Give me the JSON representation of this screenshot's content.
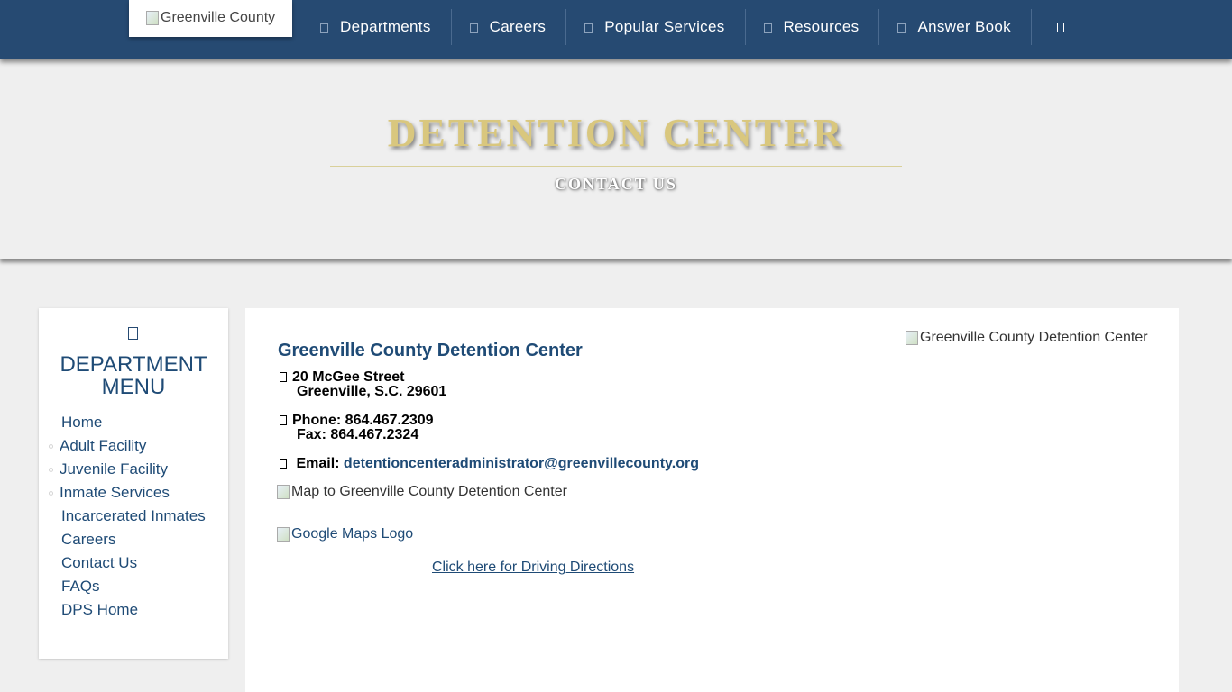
{
  "header": {
    "logo_alt": "Greenville County",
    "nav": [
      {
        "label": "Departments"
      },
      {
        "label": "Careers"
      },
      {
        "label": "Popular Services"
      },
      {
        "label": "Resources"
      },
      {
        "label": "Answer Book"
      }
    ]
  },
  "hero": {
    "title": "DETENTION CENTER",
    "subtitle": "CONTACT US"
  },
  "sidebar": {
    "title_line1": "DEPARTMENT",
    "title_line2": "MENU",
    "items": [
      {
        "label": "Home"
      },
      {
        "label": "Adult Facility"
      },
      {
        "label": "Juvenile Facility"
      },
      {
        "label": "Inmate Services"
      },
      {
        "label": "Incarcerated Inmates"
      },
      {
        "label": "Careers"
      },
      {
        "label": "Contact Us"
      },
      {
        "label": "FAQs"
      },
      {
        "label": "DPS Home"
      }
    ]
  },
  "content": {
    "title": "Greenville County Detention Center",
    "address_line1": "20 McGee Street",
    "address_line2": "Greenville, S.C. 29601",
    "phone": "Phone: 864.467.2309",
    "fax": "Fax: 864.467.2324",
    "email_label": "Email:",
    "email": "detentioncenteradministrator@greenvillecounty.org",
    "building_image_alt": "Greenville County Detention Center",
    "map_image_alt": "Map to Greenville County Detention Center",
    "google_logo_alt": "Google Maps Logo",
    "directions_link": "Click here for Driving Directions"
  }
}
